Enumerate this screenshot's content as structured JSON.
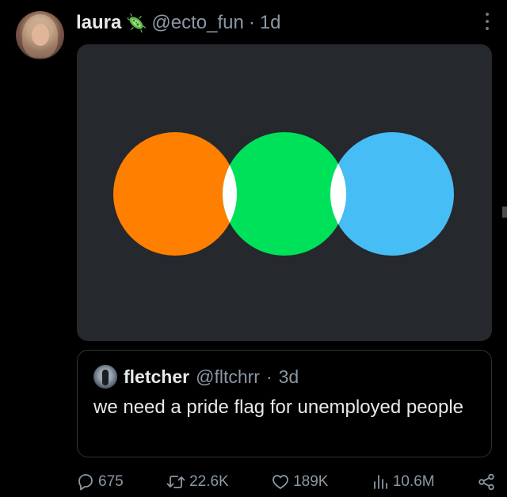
{
  "post": {
    "display_name": "laura",
    "name_emoji": "microbe-emoji",
    "handle": "@ecto_fun",
    "separator": "·",
    "time": "1d",
    "media": {
      "type": "image",
      "background": "#25282d",
      "circles": [
        "#ff7f00",
        "#00e15a",
        "#47bdf5"
      ],
      "overlap_color": "#ffffff"
    }
  },
  "quoted": {
    "display_name": "fletcher",
    "handle": "@fltchrr",
    "separator": "·",
    "time": "3d",
    "text": "we need a pride flag for unemployed people"
  },
  "actions": {
    "replies": "675",
    "reposts": "22.6K",
    "likes": "189K",
    "views": "10.6M"
  },
  "colors": {
    "background": "#000000",
    "text_primary": "#e7e9ea",
    "text_secondary": "#8b98a5",
    "border": "#2f3336"
  }
}
